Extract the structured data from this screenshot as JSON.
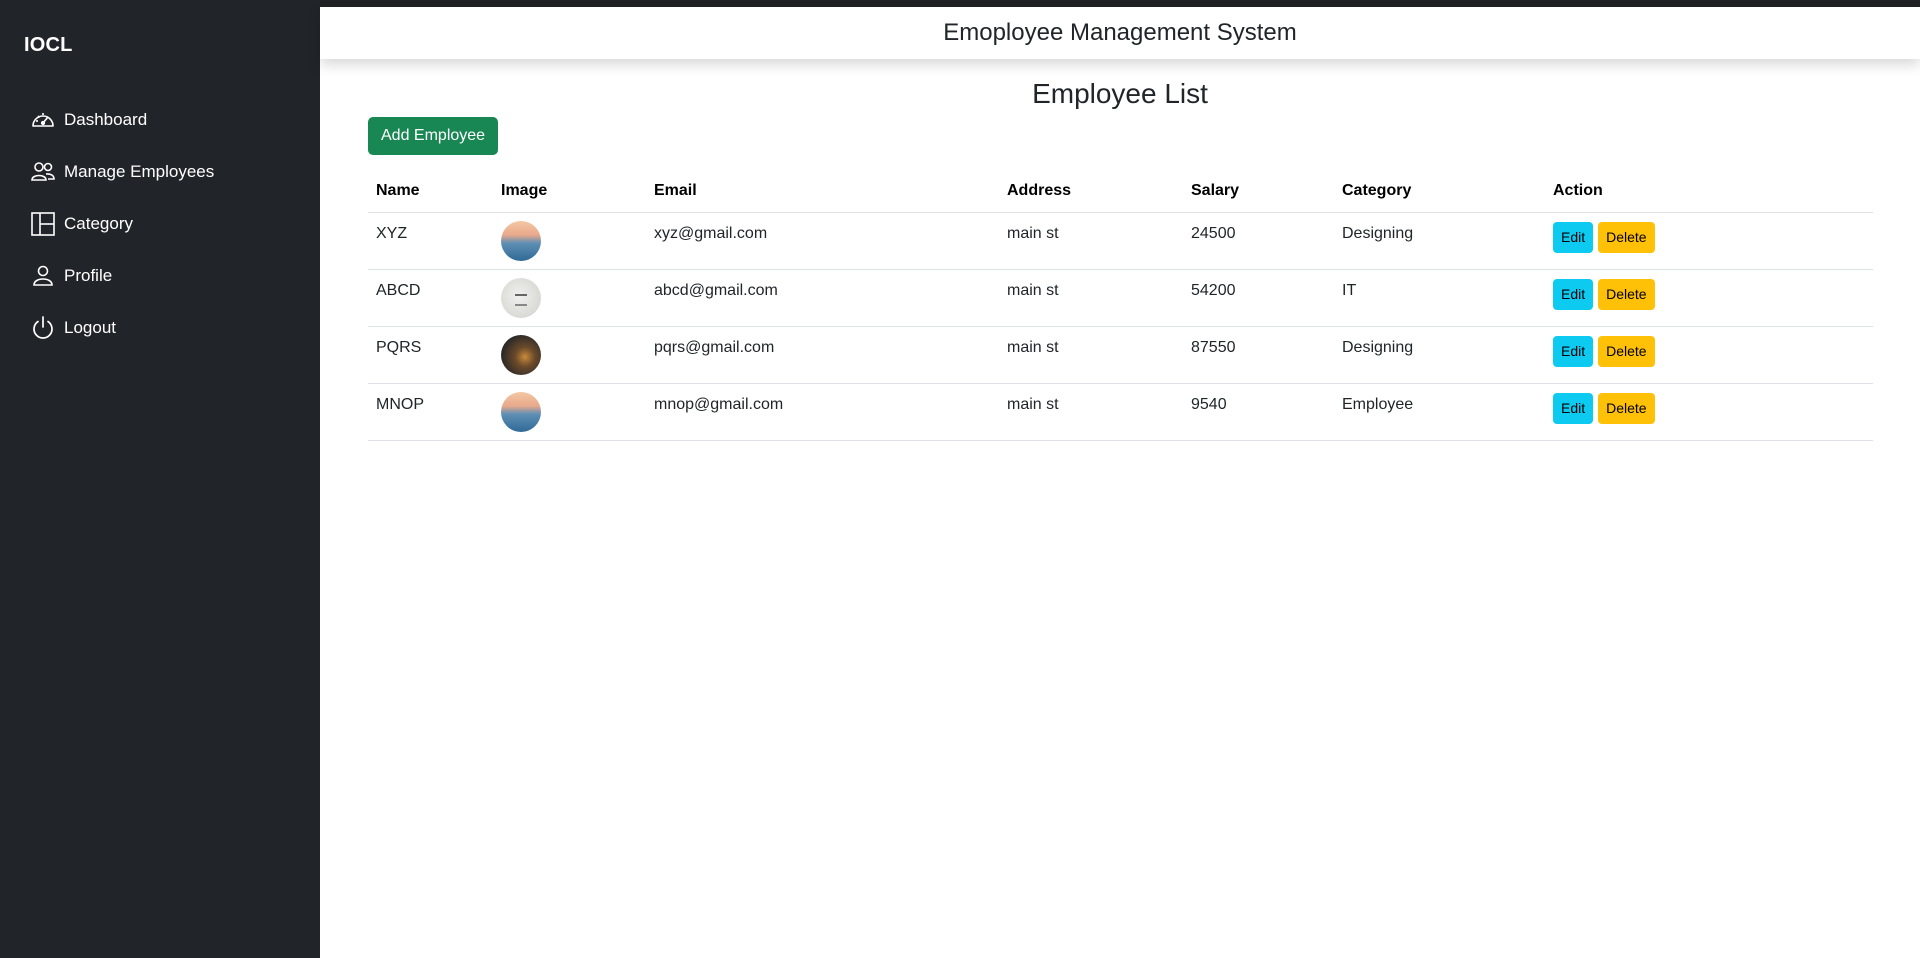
{
  "sidebar": {
    "brand": "IOCL",
    "items": [
      {
        "label": "Dashboard",
        "icon": "speedometer-icon"
      },
      {
        "label": "Manage Employees",
        "icon": "people-icon"
      },
      {
        "label": "Category",
        "icon": "layout-columns-icon"
      },
      {
        "label": "Profile",
        "icon": "person-icon"
      },
      {
        "label": "Logout",
        "icon": "power-icon"
      }
    ]
  },
  "header": {
    "title": "Emoployee Management System"
  },
  "main": {
    "title": "Employee List",
    "add_button": "Add Employee",
    "columns": [
      "Name",
      "Image",
      "Email",
      "Address",
      "Salary",
      "Category",
      "Action"
    ],
    "rows": [
      {
        "name": "XYZ",
        "image": "landscape-photo",
        "email": "xyz@gmail.com",
        "address": "main st",
        "salary": "24500",
        "category": "Designing"
      },
      {
        "name": "ABCD",
        "image": "grey-photo",
        "email": "abcd@gmail.com",
        "address": "main st",
        "salary": "54200",
        "category": "IT"
      },
      {
        "name": "PQRS",
        "image": "dark-photo",
        "email": "pqrs@gmail.com",
        "address": "main st",
        "salary": "87550",
        "category": "Designing"
      },
      {
        "name": "MNOP",
        "image": "landscape-photo",
        "email": "mnop@gmail.com",
        "address": "main st",
        "salary": "9540",
        "category": "Employee"
      }
    ],
    "edit_label": "Edit",
    "delete_label": "Delete"
  },
  "colors": {
    "sidebar_bg": "#212529",
    "success": "#198754",
    "info": "#0dcaf0",
    "warning": "#ffc107"
  }
}
